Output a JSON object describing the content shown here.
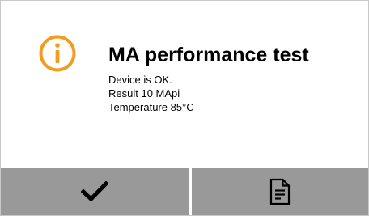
{
  "dialog": {
    "icon": "info-icon",
    "title": "MA performance test",
    "lines": [
      "Device is OK.",
      "Result 10 MApi",
      "Temperature 85°C"
    ]
  },
  "buttons": {
    "confirm_icon": "checkmark-icon",
    "report_icon": "document-icon"
  },
  "colors": {
    "accent": "#f39c1f",
    "button_bg": "#999999",
    "border": "#c8c8c8"
  }
}
